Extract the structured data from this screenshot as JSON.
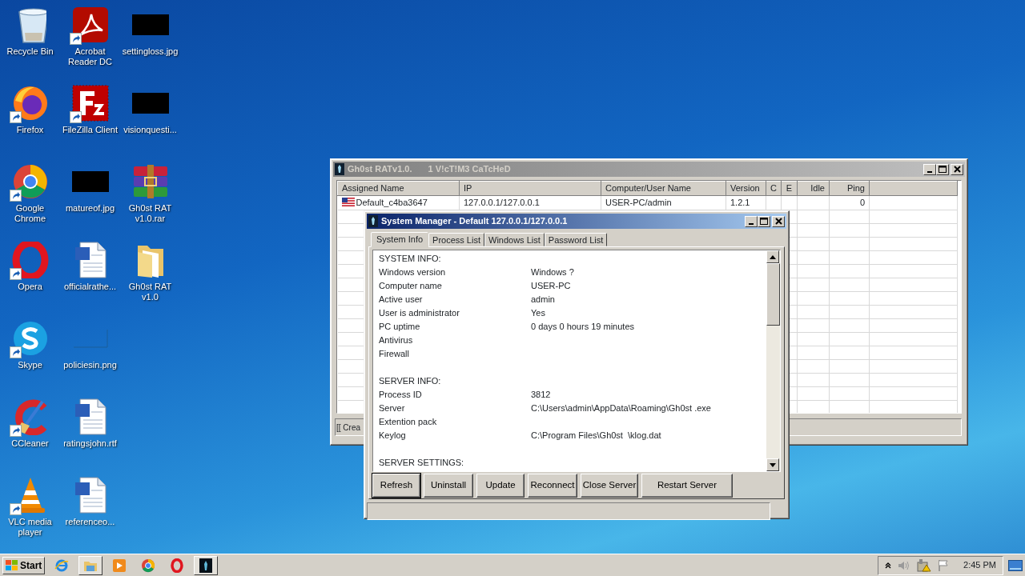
{
  "desktop": {
    "icons": [
      {
        "kind": "recycle-bin",
        "label_lines": [
          "Recycle Bin"
        ],
        "shortcut": false
      },
      {
        "kind": "firefox",
        "label_lines": [
          "Firefox"
        ],
        "shortcut": true
      },
      {
        "kind": "chrome",
        "label_lines": [
          "Google",
          "Chrome"
        ],
        "shortcut": true
      },
      {
        "kind": "opera",
        "label_lines": [
          "Opera"
        ],
        "shortcut": true
      },
      {
        "kind": "skype",
        "label_lines": [
          "Skype"
        ],
        "shortcut": true
      },
      {
        "kind": "ccleaner",
        "label_lines": [
          "CCleaner"
        ],
        "shortcut": true
      },
      {
        "kind": "vlc",
        "label_lines": [
          "VLC media",
          "player"
        ],
        "shortcut": true
      },
      {
        "kind": "acrobat",
        "label_lines": [
          "Acrobat",
          "Reader DC"
        ],
        "shortcut": true
      },
      {
        "kind": "filezilla",
        "label_lines": [
          "FileZilla Client"
        ],
        "shortcut": true
      },
      {
        "kind": "black-image",
        "label_lines": [
          "matureof.jpg"
        ],
        "shortcut": false
      },
      {
        "kind": "word-doc",
        "label_lines": [
          "officialrathe..."
        ],
        "shortcut": false
      },
      {
        "kind": "blank-image",
        "label_lines": [
          "policiesin.png"
        ],
        "shortcut": false
      },
      {
        "kind": "word-doc",
        "label_lines": [
          "ratingsjohn.rtf"
        ],
        "shortcut": false
      },
      {
        "kind": "word-doc",
        "label_lines": [
          "referenceo..."
        ],
        "shortcut": false
      },
      {
        "kind": "black-image",
        "label_lines": [
          "settingloss.jpg"
        ],
        "shortcut": false
      },
      {
        "kind": "black-image",
        "label_lines": [
          "visionquesti..."
        ],
        "shortcut": false
      },
      {
        "kind": "rar",
        "label_lines": [
          "Gh0st RAT",
          "v1.0.rar"
        ],
        "shortcut": false
      },
      {
        "kind": "folder",
        "label_lines": [
          "Gh0st RAT",
          "v1.0"
        ],
        "shortcut": false
      }
    ]
  },
  "main_window": {
    "title": "Gh0st RATv1.0.",
    "subtitle": "1 V!cT!M3 CaTcHeD",
    "active": false,
    "columns": [
      "Assigned Name",
      "IP",
      "Computer/User Name",
      "Version",
      "C",
      "E",
      "Idle",
      "Ping"
    ],
    "rows": [
      {
        "cells": [
          "Default_c4ba3647",
          "127.0.0.1/127.0.0.1",
          "USER-PC/admin",
          "1.2.1",
          "",
          "",
          "",
          "0"
        ]
      }
    ],
    "status_text": "[[ Crea"
  },
  "system_manager": {
    "title": "System Manager - Default 127.0.0.1/127.0.0.1",
    "active": true,
    "tabs": [
      {
        "label": "System Info",
        "selected": true
      },
      {
        "label": "Process List",
        "selected": false
      },
      {
        "label": "Windows List",
        "selected": false
      },
      {
        "label": "Password List",
        "selected": false
      }
    ],
    "sections": [
      {
        "heading": "SYSTEM INFO:",
        "rows": [
          {
            "label": "Windows version",
            "value": "Windows ?"
          },
          {
            "label": "Computer name",
            "value": "USER-PC"
          },
          {
            "label": "Active user",
            "value": "admin"
          },
          {
            "label": "User is administrator",
            "value": "Yes"
          },
          {
            "label": "PC uptime",
            "value": "0 days 0 hours 19 minutes"
          },
          {
            "label": "Antivirus"
          },
          {
            "label": "Firewall"
          }
        ]
      },
      {
        "heading": "SERVER INFO:",
        "rows": [
          {
            "label": "Process ID",
            "value": "3812"
          },
          {
            "label": "Server",
            "value": "C:\\Users\\admin\\AppData\\Roaming\\Gh0st .exe"
          },
          {
            "label": "Extention pack"
          },
          {
            "label": "Keylog",
            "value": "C:\\Program Files\\Gh0st  \\klog.dat"
          }
        ]
      },
      {
        "heading": "SERVER SETTINGS:"
      }
    ],
    "buttons": [
      {
        "label": "Refresh",
        "default": true
      },
      {
        "label": "Uninstall",
        "default": false
      },
      {
        "label": "Update",
        "default": false
      },
      {
        "label": "Reconnect",
        "default": false
      },
      {
        "label": "Close Server",
        "default": false
      },
      {
        "label": "Restart Server",
        "default": false
      }
    ]
  },
  "taskbar": {
    "start_label": "Start",
    "apps": [
      {
        "kind": "ie",
        "running": false
      },
      {
        "kind": "explorer",
        "running": true
      },
      {
        "kind": "media",
        "running": false
      },
      {
        "kind": "chrome",
        "running": false
      },
      {
        "kind": "opera",
        "running": false
      },
      {
        "kind": "gh0st",
        "running": true
      }
    ],
    "time": "2:45 PM"
  }
}
